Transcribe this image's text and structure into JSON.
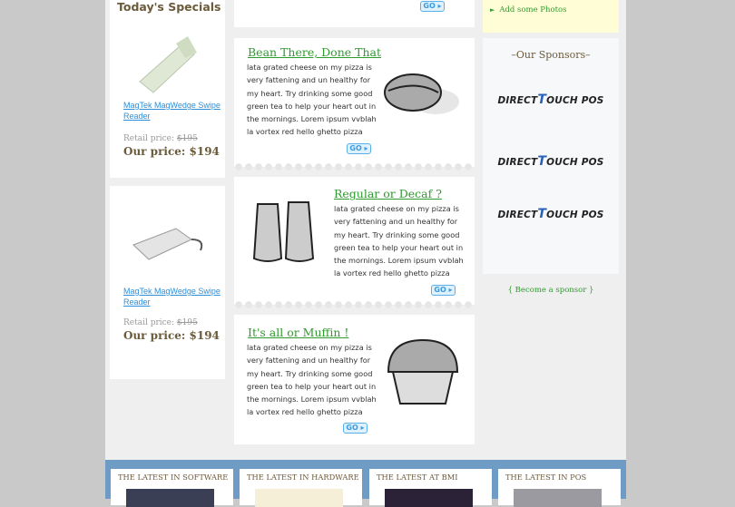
{
  "specials": {
    "title": "Today's Specials",
    "products": [
      {
        "name": "MagTek MagWedge Swipe Reader",
        "retail_label": "Retail price:",
        "retail_price": "$195",
        "our_price": "Our price: $194"
      },
      {
        "name": "MagTek MagWedge Swipe Reader",
        "retail_label": "Retail price:",
        "retail_price": "$195",
        "our_price": "Our price: $194"
      }
    ]
  },
  "articles": [
    {
      "title": "Bean There, Done That",
      "body": "lata grated cheese on my pizza is very fattening and un healthy for my heart. Try drinking some good green tea to help your heart out in the mornings. Lorem ipsum vvblah la vortex red hello ghetto pizza",
      "go": "GO ▸"
    },
    {
      "title": "Regular or Decaf ?",
      "body": "lata grated cheese on my pizza is very fattening and un healthy for my heart. Try drinking some good green tea to help your heart out in the mornings. Lorem ipsum vvblah la vortex red hello ghetto pizza",
      "go": "GO ▸"
    },
    {
      "title": "It's all or Muffin  !",
      "body": "lata grated cheese on my pizza is very fattening and un healthy for my heart. Try drinking some good green tea to help your heart out in the mornings. Lorem ipsum vvblah la vortex red hello ghetto pizza",
      "go": "GO ▸"
    }
  ],
  "top_go": "GO ▸",
  "sidebar": {
    "add_photos": "Add some Photos",
    "sponsors_title": "–Our Sponsors–",
    "sponsor_logo": {
      "a": "DIRECT",
      "b": "T",
      "c": "OUCH POS"
    },
    "become_sponsor": "{ Become a sponsor }"
  },
  "latest": [
    "THE LATEST IN SOFTWARE",
    "THE LATEST IN HARDWARE",
    "THE LATEST AT BMI",
    "THE LATEST IN POS"
  ],
  "colors": {
    "green_link": "#2f9a2f",
    "blue_link": "#2f8fd8",
    "band": "#6f9cc4",
    "heading": "#6b5a3a"
  }
}
